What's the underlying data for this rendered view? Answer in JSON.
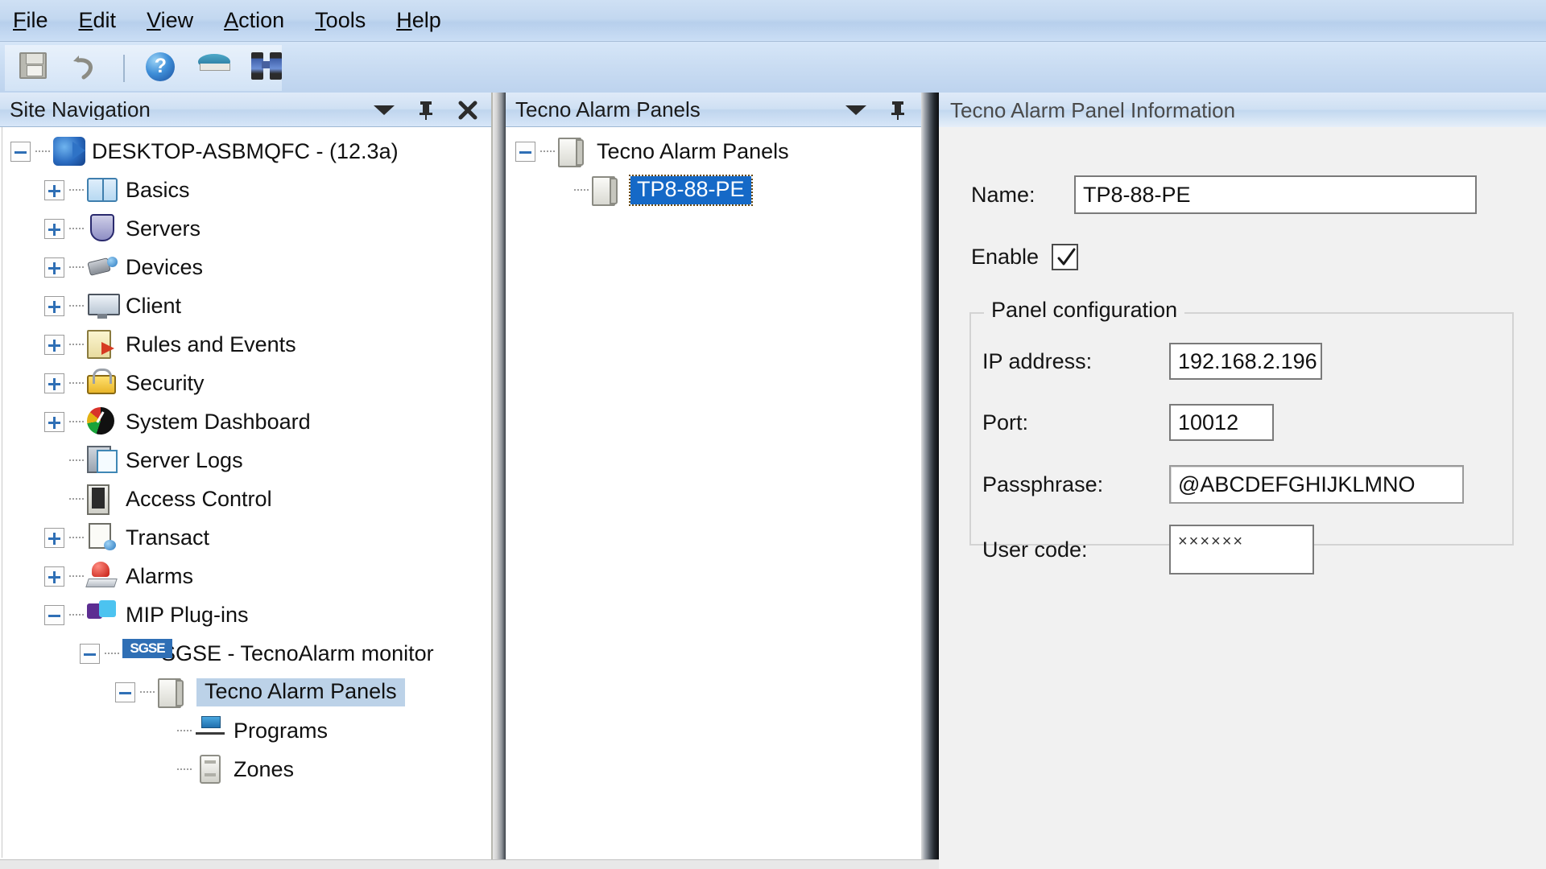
{
  "menubar": {
    "items": [
      {
        "label": "File",
        "accel": "F"
      },
      {
        "label": "Edit",
        "accel": "E"
      },
      {
        "label": "View",
        "accel": "V"
      },
      {
        "label": "Action",
        "accel": "A"
      },
      {
        "label": "Tools",
        "accel": "T"
      },
      {
        "label": "Help",
        "accel": "H"
      }
    ]
  },
  "toolbar": {
    "buttons": [
      {
        "name": "save-icon",
        "tooltip": "Save"
      },
      {
        "name": "undo-icon",
        "tooltip": "Undo"
      },
      {
        "name": "help-icon",
        "tooltip": "Help"
      },
      {
        "name": "book-icon",
        "tooltip": "Documentation"
      },
      {
        "name": "binoculars-icon",
        "tooltip": "Find"
      }
    ]
  },
  "site_navigation": {
    "title": "Site Navigation",
    "header_buttons": [
      "chevron-down-icon",
      "pin-icon",
      "close-icon"
    ],
    "tree": [
      {
        "label": "DESKTOP-ASBMQFC - (12.3a)",
        "depth": 0,
        "expander": "minus",
        "icon": "server-globe"
      },
      {
        "label": "Basics",
        "depth": 1,
        "expander": "plus",
        "icon": "book"
      },
      {
        "label": "Servers",
        "depth": 1,
        "expander": "plus",
        "icon": "shield"
      },
      {
        "label": "Devices",
        "depth": 1,
        "expander": "plus",
        "icon": "camera"
      },
      {
        "label": "Client",
        "depth": 1,
        "expander": "plus",
        "icon": "monitor"
      },
      {
        "label": "Rules and Events",
        "depth": 1,
        "expander": "plus",
        "icon": "rules"
      },
      {
        "label": "Security",
        "depth": 1,
        "expander": "plus",
        "icon": "security"
      },
      {
        "label": "System Dashboard",
        "depth": 1,
        "expander": "plus",
        "icon": "dashboard"
      },
      {
        "label": "Server Logs",
        "depth": 1,
        "expander": "none",
        "icon": "logs"
      },
      {
        "label": "Access Control",
        "depth": 1,
        "expander": "none",
        "icon": "access"
      },
      {
        "label": "Transact",
        "depth": 1,
        "expander": "plus",
        "icon": "transact"
      },
      {
        "label": "Alarms",
        "depth": 1,
        "expander": "plus",
        "icon": "alarm"
      },
      {
        "label": "MIP Plug-ins",
        "depth": 1,
        "expander": "minus",
        "icon": "mip"
      },
      {
        "label": "SGSE - TecnoAlarm monitor",
        "depth": 2,
        "expander": "minus",
        "icon": "sgse"
      },
      {
        "label": "Tecno Alarm Panels",
        "depth": 3,
        "expander": "minus",
        "icon": "panelbox",
        "selected": "soft"
      },
      {
        "label": "Programs",
        "depth": 4,
        "expander": "none",
        "icon": "programs"
      },
      {
        "label": "Zones",
        "depth": 4,
        "expander": "none",
        "icon": "zones"
      }
    ]
  },
  "panels_view": {
    "title": "Tecno Alarm Panels",
    "header_buttons": [
      "chevron-down-icon",
      "pin-icon"
    ],
    "tree": [
      {
        "label": "Tecno Alarm Panels",
        "depth": 0,
        "expander": "minus",
        "icon": "panelbox"
      },
      {
        "label": "TP8-88-PE",
        "depth": 1,
        "expander": "none",
        "icon": "panelbox",
        "selected": "blue"
      }
    ]
  },
  "info_panel": {
    "title": "Tecno Alarm Panel Information",
    "name_label": "Name:",
    "name_value": "TP8-88-PE",
    "enable_label": "Enable",
    "enable_checked": true,
    "group": {
      "legend": "Panel configuration",
      "fields": [
        {
          "label": "IP address:",
          "value": "192.168.2.196",
          "name": "ip-address-input"
        },
        {
          "label": "Port:",
          "value": "10012",
          "name": "port-input"
        },
        {
          "label": "Passphrase:",
          "value": "@ABCDEFGHIJKLMNO",
          "name": "passphrase-input"
        },
        {
          "label": "User code:",
          "value": "××××××",
          "name": "user-code-input",
          "masked": true
        }
      ]
    }
  },
  "colors": {
    "selection_blue": "#1569c7",
    "selection_soft": "#bcd2e8",
    "titlebar_blue": "#cfe0f3",
    "panel_bg": "#f1f1f1"
  }
}
